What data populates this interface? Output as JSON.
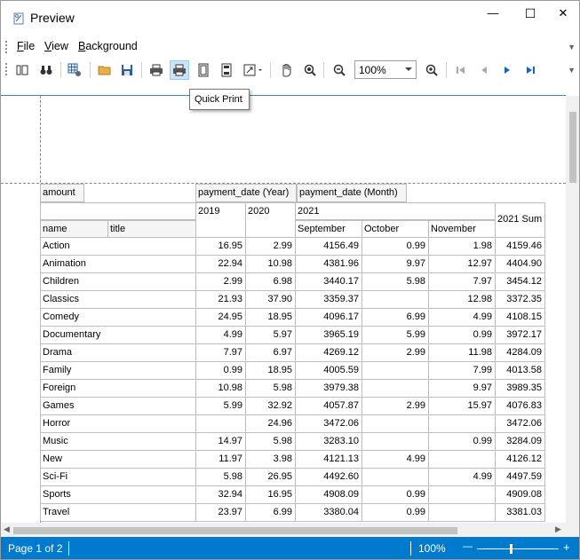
{
  "window": {
    "title": "Preview",
    "minimize_glyph": "—",
    "maximize_glyph": "☐",
    "close_glyph": "✕"
  },
  "menu": {
    "file": {
      "label": "File",
      "accel": "F",
      "rest": "ile"
    },
    "view": {
      "label": "View",
      "accel": "V",
      "rest": "iew"
    },
    "background": {
      "label": "Background",
      "accel": "B",
      "rest": "ackground"
    }
  },
  "toolbar": {
    "zoom_value": "100%",
    "tooltip": "Quick Print"
  },
  "report": {
    "measure_label": "amount",
    "col_field_year": "payment_date (Year)",
    "col_field_month": "payment_date (Month)",
    "row_field_name": "name",
    "row_field_title": "title",
    "year_2019": "2019",
    "year_2020": "2020",
    "year_2021": "2021",
    "month_sep": "September",
    "month_oct": "October",
    "month_nov": "November",
    "sum_2021": "2021 Sum",
    "rows": [
      {
        "name": "Action",
        "y2019": "16.95",
        "y2020": "2.99",
        "sep": "4156.49",
        "oct": "0.99",
        "nov": "1.98",
        "sum": "4159.46"
      },
      {
        "name": "Animation",
        "y2019": "22.94",
        "y2020": "10.98",
        "sep": "4381.96",
        "oct": "9.97",
        "nov": "12.97",
        "sum": "4404.90"
      },
      {
        "name": "Children",
        "y2019": "2.99",
        "y2020": "6.98",
        "sep": "3440.17",
        "oct": "5.98",
        "nov": "7.97",
        "sum": "3454.12"
      },
      {
        "name": "Classics",
        "y2019": "21.93",
        "y2020": "37.90",
        "sep": "3359.37",
        "oct": "",
        "nov": "12.98",
        "sum": "3372.35"
      },
      {
        "name": "Comedy",
        "y2019": "24.95",
        "y2020": "18.95",
        "sep": "4096.17",
        "oct": "6.99",
        "nov": "4.99",
        "sum": "4108.15"
      },
      {
        "name": "Documentary",
        "y2019": "4.99",
        "y2020": "5.97",
        "sep": "3965.19",
        "oct": "5.99",
        "nov": "0.99",
        "sum": "3972.17"
      },
      {
        "name": "Drama",
        "y2019": "7.97",
        "y2020": "6.97",
        "sep": "4269.12",
        "oct": "2.99",
        "nov": "11.98",
        "sum": "4284.09"
      },
      {
        "name": "Family",
        "y2019": "0.99",
        "y2020": "18.95",
        "sep": "4005.59",
        "oct": "",
        "nov": "7.99",
        "sum": "4013.58"
      },
      {
        "name": "Foreign",
        "y2019": "10.98",
        "y2020": "5.98",
        "sep": "3979.38",
        "oct": "",
        "nov": "9.97",
        "sum": "3989.35"
      },
      {
        "name": "Games",
        "y2019": "5.99",
        "y2020": "32.92",
        "sep": "4057.87",
        "oct": "2.99",
        "nov": "15.97",
        "sum": "4076.83"
      },
      {
        "name": "Horror",
        "y2019": "",
        "y2020": "24.96",
        "sep": "3472.06",
        "oct": "",
        "nov": "",
        "sum": "3472.06"
      },
      {
        "name": "Music",
        "y2019": "14.97",
        "y2020": "5.98",
        "sep": "3283.10",
        "oct": "",
        "nov": "0.99",
        "sum": "3284.09"
      },
      {
        "name": "New",
        "y2019": "11.97",
        "y2020": "3.98",
        "sep": "4121.13",
        "oct": "4.99",
        "nov": "",
        "sum": "4126.12"
      },
      {
        "name": "Sci-Fi",
        "y2019": "5.98",
        "y2020": "26.95",
        "sep": "4492.60",
        "oct": "",
        "nov": "4.99",
        "sum": "4497.59"
      },
      {
        "name": "Sports",
        "y2019": "32.94",
        "y2020": "16.95",
        "sep": "4908.09",
        "oct": "0.99",
        "nov": "",
        "sum": "4909.08"
      },
      {
        "name": "Travel",
        "y2019": "23.97",
        "y2020": "6.99",
        "sep": "3380.04",
        "oct": "0.99",
        "nov": "",
        "sum": "3381.03"
      }
    ]
  },
  "status": {
    "page": "Page 1 of 2",
    "zoom": "100%",
    "minus": "—",
    "plus": "+"
  },
  "colors": {
    "accent": "#007acc",
    "active_button": "#cce4f7"
  }
}
